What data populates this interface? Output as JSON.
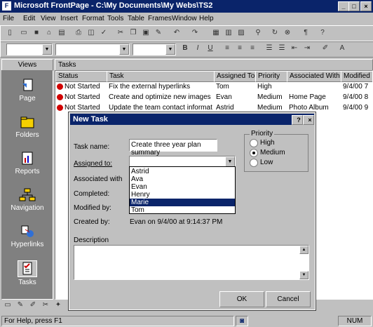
{
  "app": {
    "title": "Microsoft FrontPage - C:\\My Documents\\My Webs\\TS2"
  },
  "menu": [
    "File",
    "Edit",
    "View",
    "Insert",
    "Format",
    "Tools",
    "Table",
    "Frames",
    "Window",
    "Help"
  ],
  "views": {
    "header": "Views",
    "items": [
      {
        "label": "Page",
        "icon": "page-view-icon"
      },
      {
        "label": "Folders",
        "icon": "folders-view-icon"
      },
      {
        "label": "Reports",
        "icon": "reports-view-icon"
      },
      {
        "label": "Navigation",
        "icon": "navigation-view-icon"
      },
      {
        "label": "Hyperlinks",
        "icon": "hyperlinks-view-icon"
      },
      {
        "label": "Tasks",
        "icon": "tasks-view-icon"
      }
    ]
  },
  "tasks": {
    "header": "Tasks",
    "columns": [
      "Status",
      "Task",
      "Assigned To",
      "Priority",
      "Associated With",
      "Modified"
    ],
    "rows": [
      {
        "status": "Not Started",
        "task": "Fix the external hyperlinks",
        "assigned": "Tom",
        "priority": "High",
        "associated": "",
        "modified": "9/4/00 7"
      },
      {
        "status": "Not Started",
        "task": "Create and optimize new images",
        "assigned": "Evan",
        "priority": "Medium",
        "associated": "Home Page",
        "modified": "9/4/00 8"
      },
      {
        "status": "Not Started",
        "task": "Update the team contact information",
        "assigned": "Astrid",
        "priority": "Medium",
        "associated": "Photo Album",
        "modified": "9/4/00 9"
      }
    ]
  },
  "dialog": {
    "title": "New Task",
    "task_name_label": "Task name:",
    "task_name_value": "Create three year plan summary",
    "assigned_label": "Assigned to:",
    "assigned_value": "",
    "associated_label": "Associated with",
    "completed_label": "Completed:",
    "modified_label": "Modified by:",
    "created_label": "Created by:",
    "created_value": "Evan on 9/4/00 at 9:14:37 PM",
    "description_label": "Description",
    "priority": {
      "label": "Priority",
      "high": "High",
      "medium": "Medium",
      "low": "Low",
      "selected": "Medium"
    },
    "dropdown_options": [
      "Astrid",
      "Ava",
      "Evan",
      "Henry",
      "Marie",
      "Tom"
    ],
    "dropdown_selected": "Marie",
    "ok": "OK",
    "cancel": "Cancel"
  },
  "status": {
    "text": "For Help, press F1",
    "right": "NUM"
  }
}
